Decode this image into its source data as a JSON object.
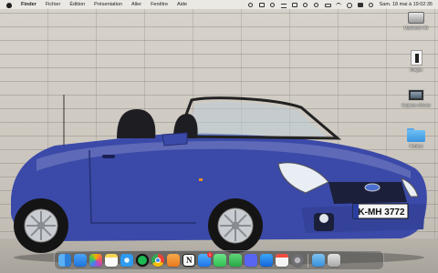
{
  "menubar": {
    "app_name": "Finder",
    "menus": [
      "Fichier",
      "Édition",
      "Présentation",
      "Aller",
      "Fenêtre",
      "Aide"
    ],
    "clock": "Sam. 18 mai à 19:02:35"
  },
  "wallpaper": {
    "plate_text": "K-MH 3772",
    "car_color": "#3b4aa8"
  },
  "desktop": {
    "items": [
      {
        "label": "Macintosh HD",
        "icon": "hard-drive-icon"
      },
      {
        "label": "Images",
        "icon": "image-file-icon"
      },
      {
        "label": "Captures d'écran",
        "icon": "screenshot-icon"
      },
      {
        "label": "Fichiers",
        "icon": "folder-icon"
      }
    ]
  },
  "dock": {
    "apps": [
      {
        "name": "finder",
        "color": "#3d8ee8"
      },
      {
        "name": "mail",
        "color": "#2f7fe0"
      },
      {
        "name": "photos",
        "color": "#f0f0f0"
      },
      {
        "name": "notes",
        "color": "#f6d657"
      },
      {
        "name": "safari",
        "color": "#2e9bf0"
      },
      {
        "name": "spotify",
        "color": "#1db954"
      },
      {
        "name": "chrome",
        "color": "#f2f2f2"
      },
      {
        "name": "pages",
        "color": "#f08b2a"
      },
      {
        "name": "notion",
        "color": "#ffffff"
      },
      {
        "name": "app-store",
        "color": "#2a8cf0"
      },
      {
        "name": "messages",
        "color": "#34c759"
      },
      {
        "name": "facetime",
        "color": "#30b94d"
      },
      {
        "name": "discord",
        "color": "#5865f2"
      },
      {
        "name": "appstore-2",
        "color": "#1e8ef0"
      },
      {
        "name": "calendar",
        "color": "#f4f4f4"
      },
      {
        "name": "settings",
        "color": "#8e8e93"
      },
      {
        "name": "screen-capture",
        "color": "#3aa0e8"
      },
      {
        "name": "trash",
        "color": "#c7c7c7"
      }
    ],
    "badge_count": "1"
  }
}
